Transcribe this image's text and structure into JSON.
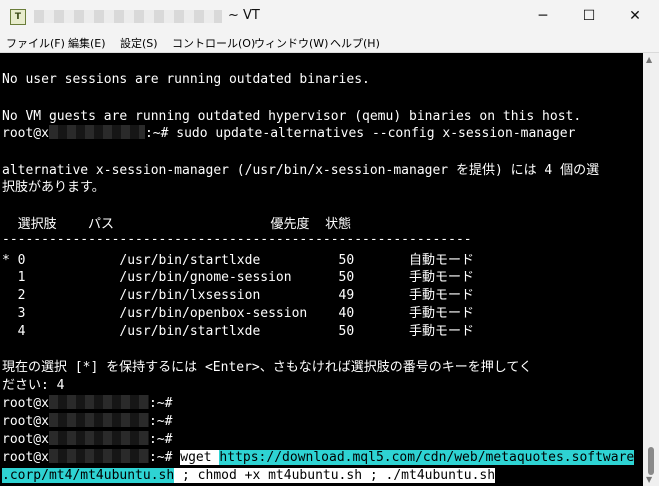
{
  "window": {
    "title": "~ VT",
    "minimize": "─",
    "maximize": "☐",
    "close": "✕",
    "icon": "T"
  },
  "menu": [
    "ファイル(F)",
    "編集(E)",
    "設定(S)",
    "コントロール(O)",
    "ウィンドウ(W)",
    "ヘルプ(H)"
  ],
  "terminal": {
    "line1": "No user sessions are running outdated binaries.",
    "line2": "No VM guests are running outdated hypervisor (qemu) binaries on this host.",
    "prompt1_prefix": "root@x",
    "prompt1_cmd": ":~# sudo update-alternatives --config x-session-manager",
    "alt_line1": "alternative x-session-manager (/usr/bin/x-session-manager を提供) には 4 個の選",
    "alt_line2": "択肢があります。",
    "table_header": "  選択肢    パス                    優先度  状態",
    "separator": "------------------------------------------------------------",
    "rows": [
      "* 0            /usr/bin/startlxde          50       自動モード",
      "  1            /usr/bin/gnome-session      50       手動モード",
      "  2            /usr/bin/lxsession          49       手動モード",
      "  3            /usr/bin/openbox-session    40       手動モード",
      "  4            /usr/bin/startlxde          50       手動モード"
    ],
    "select_line1": "現在の選択 [*] を保持するには <Enter>、さもなければ選択肢の番号のキーを押してく",
    "select_line2": "ださい: 4",
    "prompt_prefix": "root@x",
    "prompt_suffix": ":~#",
    "final_suffix": ":~# ",
    "cmd_wget": "wget ",
    "cmd_url1": "https://download.mql5.com/cdn/web/metaquotes.software",
    "cmd_url2": ".corp/mt4/mt4ubuntu.sh",
    "cmd_rest": " ; chmod +x mt4ubuntu.sh ; ./mt4ubuntu.sh"
  },
  "scrollbar": {
    "up_icon": "▲",
    "down_icon": "▼"
  }
}
